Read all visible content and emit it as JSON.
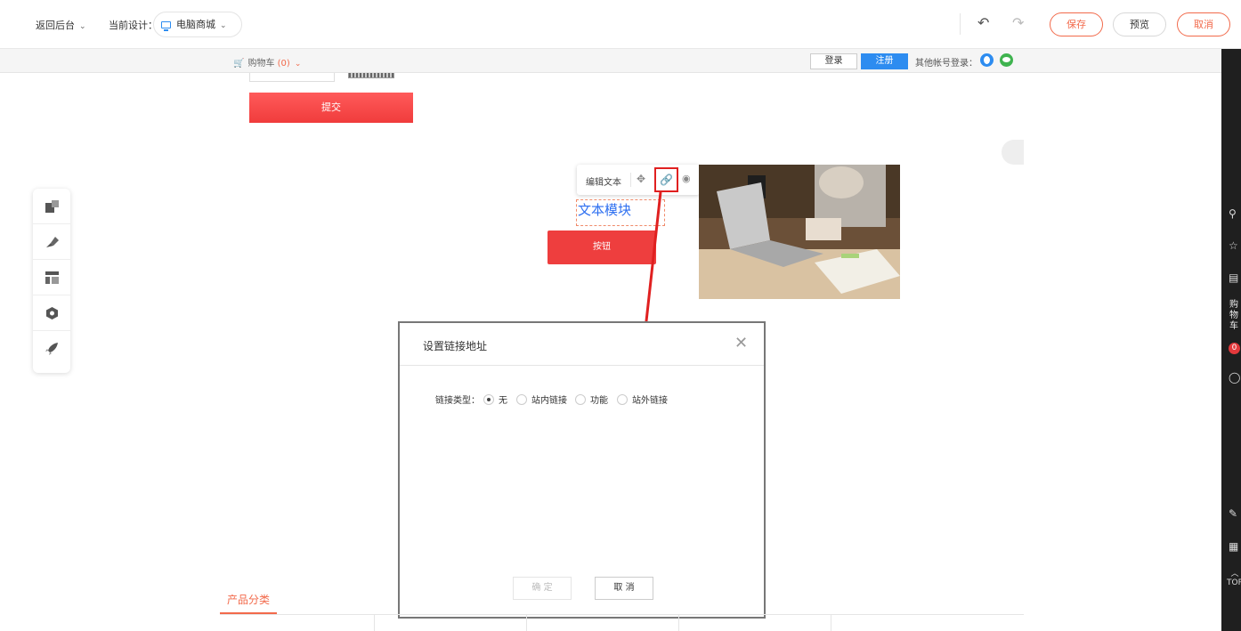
{
  "toolbar": {
    "back_label": "返回后台",
    "design_label": "当前设计：",
    "design_value": "电脑商城",
    "undo_icon": "undo-icon",
    "redo_icon": "redo-icon",
    "save_label": "保存",
    "preview_label": "预览",
    "cancel_label": "取消"
  },
  "site_header": {
    "cart_label": "购物车",
    "cart_count": "(0)",
    "login_label": "登录",
    "register_label": "注册",
    "other_login_label": "其他帐号登录：",
    "accent_color": "#f26a4b",
    "primary_color": "#2d8cf0"
  },
  "form": {
    "submit_label": "提交"
  },
  "widget_toolbar": {
    "edit_text_label": "编辑文本"
  },
  "canvas": {
    "text_module": "文本模块",
    "button_label": "按钮"
  },
  "right_sidebar": {
    "cart_label": [
      "购",
      "物",
      "车"
    ],
    "cart_badge": "0",
    "top_label": "TOP"
  },
  "modal": {
    "title": "设置链接地址",
    "link_type_label": "链接类型：",
    "options": [
      "无",
      "站内链接",
      "功能",
      "站外链接"
    ],
    "selected_option": "无",
    "confirm_label": "确 定",
    "cancel_label": "取 消"
  },
  "product_category": {
    "tab_label": "产品分类"
  }
}
